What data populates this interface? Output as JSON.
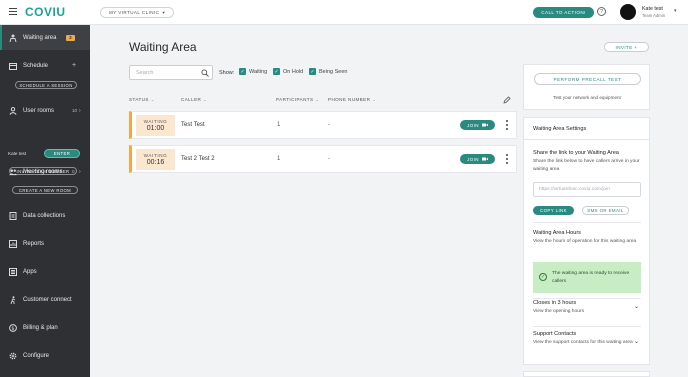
{
  "topbar": {
    "logo": "COVIU",
    "clinic_select": "MY VIRTUAL CLINIC",
    "cta": "CALL TO ACTION!",
    "help": "?",
    "user_name": "Kate test",
    "user_role": "Team Admin"
  },
  "sidebar": {
    "waiting_area": {
      "label": "Waiting area",
      "badge": "2"
    },
    "schedule": {
      "label": "Schedule",
      "plus": "+",
      "button": "SCHEDULE A SESSION"
    },
    "user_rooms": {
      "label": "User rooms",
      "count": "10",
      "caret": "›",
      "member": "Kate test",
      "enter": "ENTER",
      "invite": "INVITE TEAM MEMBER"
    },
    "meeting_rooms": {
      "label": "Meeting rooms",
      "count": "0",
      "caret": "›",
      "button": "CREATE A NEW ROOM"
    },
    "data_collections": "Data collections",
    "reports": "Reports",
    "apps": "Apps",
    "customer_connect": "Customer connect",
    "billing": "Billing & plan",
    "configure": "Configure"
  },
  "main": {
    "title": "Waiting Area",
    "invite": "INVITE +",
    "search_placeholder": "Search",
    "show_label": "Show:",
    "filters": [
      "Waiting",
      "On Hold",
      "Being Seen"
    ],
    "headers": {
      "status": "STATUS",
      "caller": "CALLER",
      "participants": "PARTICIPANTS",
      "phone": "PHONE NUMBER"
    },
    "rows": [
      {
        "status": "WAITING",
        "time": "01:00",
        "caller": "Test Test",
        "participants": "1",
        "phone": "-",
        "join": "JOIN"
      },
      {
        "status": "WAITING",
        "time": "00:16",
        "caller": "Test 2 Test 2",
        "participants": "1",
        "phone": "-",
        "join": "JOIN"
      }
    ]
  },
  "panel": {
    "precall_button": "PERFORM PRECALL TEST",
    "precall_sub": "Test your network and equipment",
    "settings_title": "Waiting Area Settings",
    "share_title": "Share the link to your Waiting Area",
    "share_sub": "Share the link below to have callers arrive in your waiting area",
    "url": "https://virtualclinic.coviu.com/join",
    "copy_link": "COPY LINK",
    "sms_email": "SMS OR EMAIL",
    "hours_title": "Waiting Area Hours",
    "hours_sub": "View the hours of operation for this waiting area",
    "ready_text": "The waiting area is ready to receive callers",
    "closes_title": "Closes in 3 hours",
    "closes_sub": "View the opening hours",
    "contacts_title": "Support Contacts",
    "contacts_sub": "View the support contacts for this waiting area"
  },
  "colors": {
    "accent": "#2a8a80",
    "sidebar": "#2e3033",
    "waiting": "#f0a84a",
    "ready": "#c8ecc4"
  }
}
